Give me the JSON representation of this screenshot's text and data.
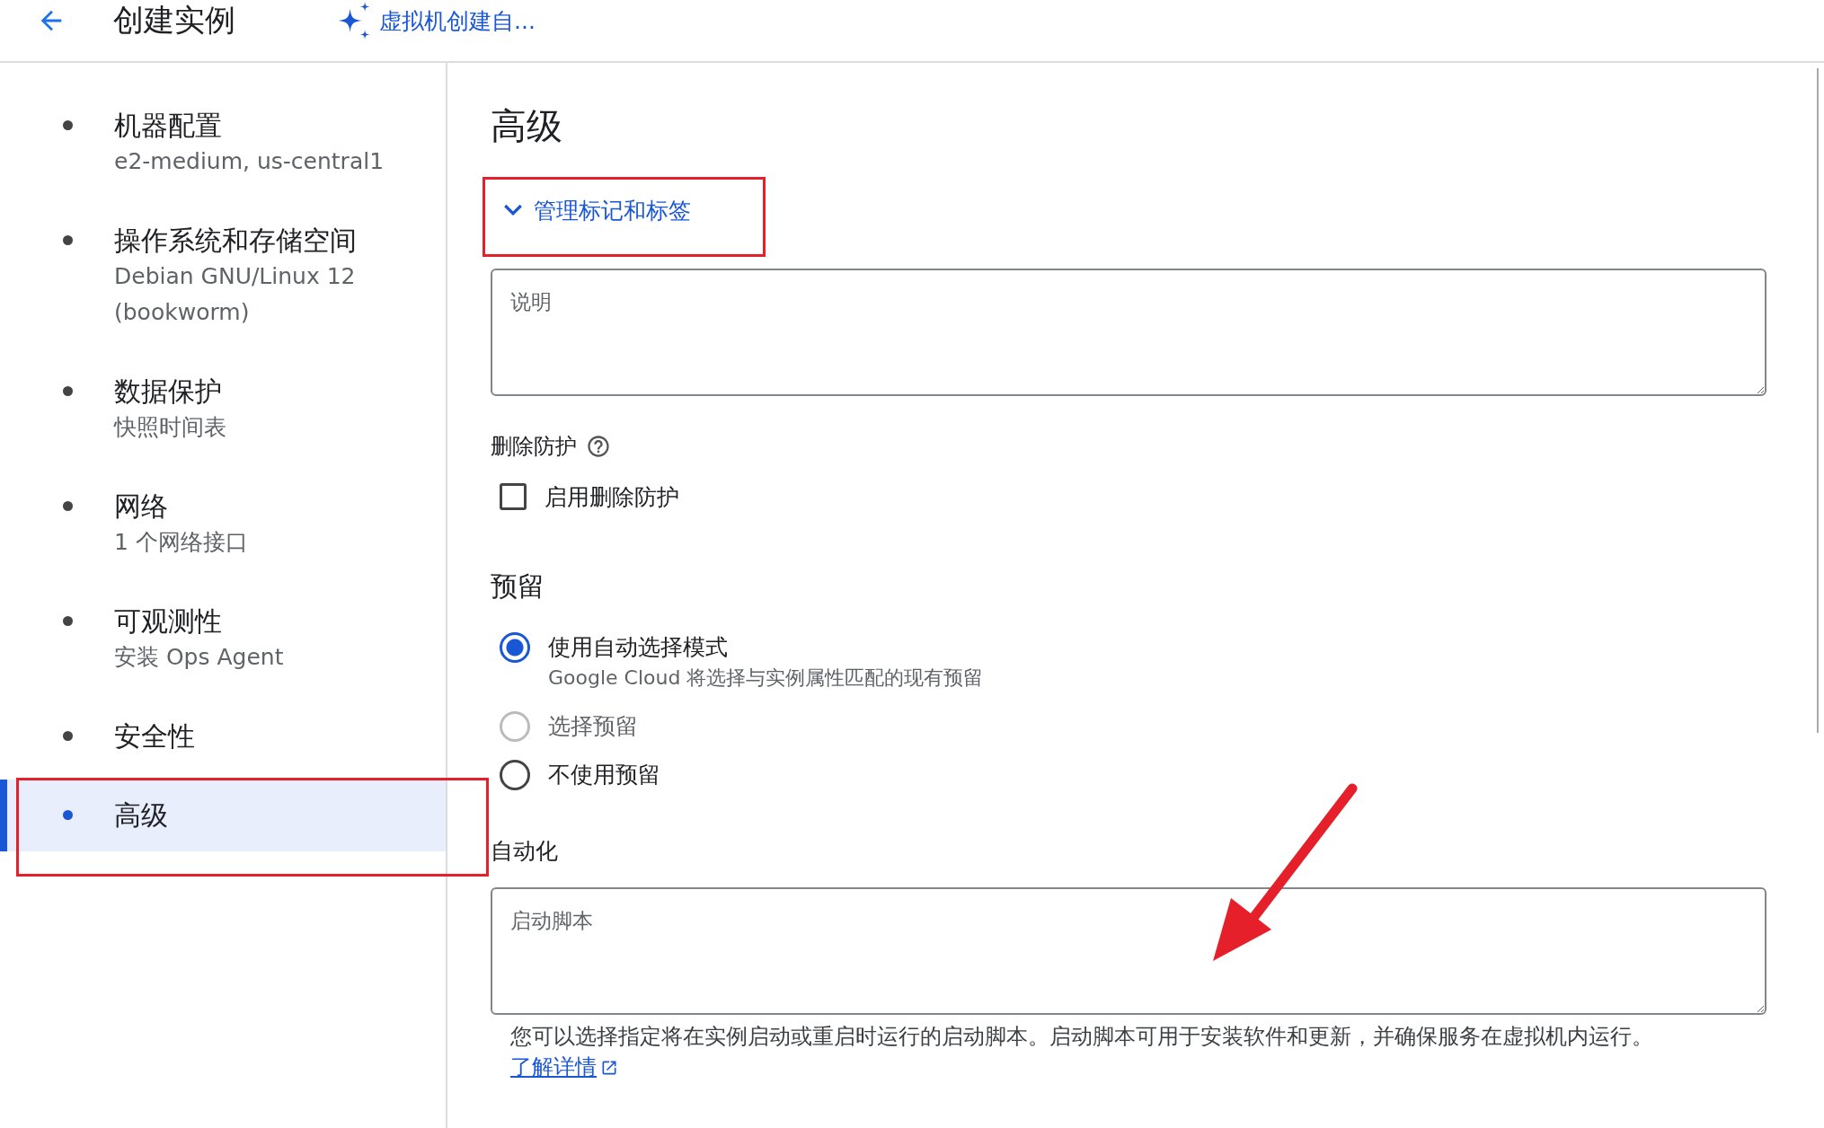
{
  "header": {
    "title": "创建实例",
    "assist_link": "虚拟机创建自..."
  },
  "sidebar": {
    "items": [
      {
        "title": "机器配置",
        "subtitle": "e2-medium, us-central1",
        "selected": false
      },
      {
        "title": "操作系统和存储空间",
        "subtitle": "Debian GNU/Linux 12 (bookworm)",
        "selected": false
      },
      {
        "title": "数据保护",
        "subtitle": "快照时间表",
        "selected": false
      },
      {
        "title": "网络",
        "subtitle": "1 个网络接口",
        "selected": false
      },
      {
        "title": "可观测性",
        "subtitle": "安装 Ops Agent",
        "selected": false
      },
      {
        "title": "安全性",
        "selected": false
      },
      {
        "title": "高级",
        "selected": true
      }
    ]
  },
  "main": {
    "heading": "高级",
    "expander": {
      "label": "管理标记和标签",
      "expanded": true
    },
    "description_field": {
      "placeholder": "说明"
    },
    "deletion_protection": {
      "label": "删除防护",
      "checkbox_label": "启用删除防护",
      "checked": false
    },
    "reservation": {
      "heading": "预留",
      "options": [
        {
          "label": "使用自动选择模式",
          "hint": "Google Cloud 将选择与实例属性匹配的现有预留",
          "selected": true,
          "disabled": false
        },
        {
          "label": "选择预留",
          "selected": false,
          "disabled": true
        },
        {
          "label": "不使用预留",
          "selected": false,
          "disabled": false
        }
      ]
    },
    "automation": {
      "heading": "自动化",
      "startup_script": {
        "placeholder": "启动脚本"
      },
      "help_text": "您可以选择指定将在实例启动或重启时运行的启动脚本。启动脚本可用于安装软件和更新，并确保服务在虚拟机内运行。",
      "help_link": "了解详情"
    }
  }
}
